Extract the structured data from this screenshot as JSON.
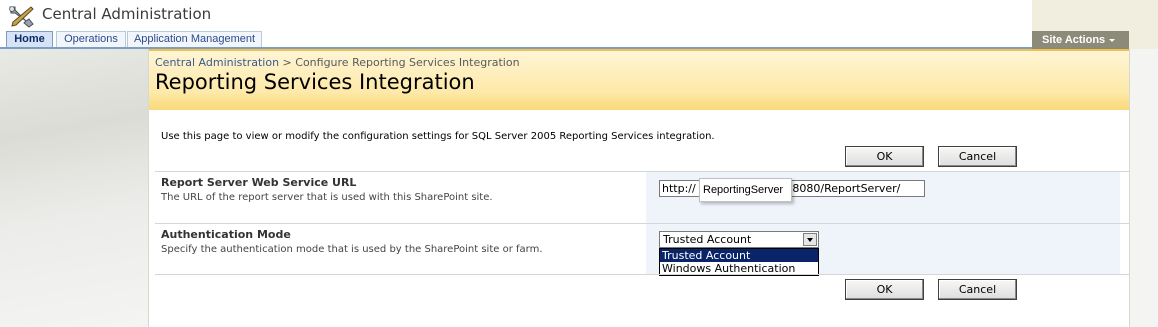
{
  "app": {
    "title": "Central Administration"
  },
  "tabs": [
    {
      "label": "Home",
      "selected": true
    },
    {
      "label": "Operations",
      "selected": false
    },
    {
      "label": "Application Management",
      "selected": false
    }
  ],
  "site_actions": {
    "label": "Site Actions"
  },
  "breadcrumb": {
    "root": "Central Administration",
    "separator": ">",
    "current": "Configure Reporting Services Integration"
  },
  "page": {
    "title": "Reporting Services Integration",
    "description": "Use this page to view or modify the configuration settings for SQL Server 2005 Reporting Services integration."
  },
  "buttons": {
    "ok": "OK",
    "cancel": "Cancel"
  },
  "sections": {
    "url": {
      "title": "Report Server Web Service URL",
      "description": "The URL of the report server that is used with this SharePoint site.",
      "value_prefix": "http://",
      "value_suffix": ":8080/ReportServer/",
      "tooltip": "ReportingServer"
    },
    "auth": {
      "title": "Authentication Mode",
      "description": "Specify the authentication mode that is used by the SharePoint site or farm.",
      "selected": "Trusted Account",
      "options": [
        "Trusted Account",
        "Windows Authentication"
      ]
    }
  },
  "icons": {
    "app_icon": "tools-icon",
    "site_actions_caret": "chevron-down-icon",
    "select_caret": "dropdown-arrow-icon"
  },
  "colors": {
    "header_band": "#fde9a8",
    "tab_border": "#7b9ec4",
    "site_actions_bg": "#8c8a78",
    "section_panel": "#eef4fa",
    "dropdown_highlight": "#0a246a"
  }
}
